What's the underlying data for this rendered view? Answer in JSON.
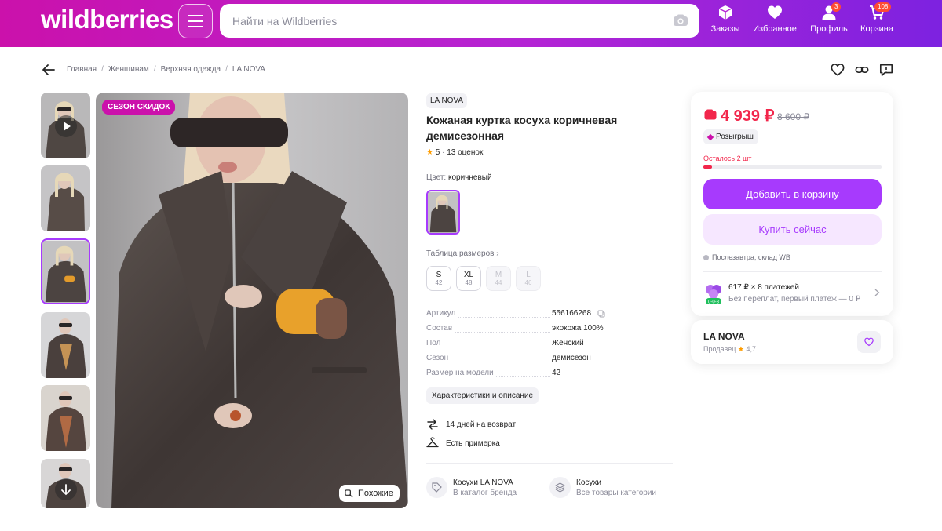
{
  "header": {
    "logo": "wildberries",
    "search_placeholder": "Найти на Wildberries",
    "nav": {
      "orders": "Заказы",
      "favorites": "Избранное",
      "profile": "Профиль",
      "profile_badge": "3",
      "cart": "Корзина",
      "cart_badge": "108"
    }
  },
  "breadcrumb": [
    "Главная",
    "Женщинам",
    "Верхняя одежда",
    "LA NOVA"
  ],
  "gallery": {
    "badge": "СЕЗОН СКИДОК",
    "similar": "Похожие",
    "thumb_count": 6,
    "active_thumb": 3
  },
  "product": {
    "brand": "LA NOVA",
    "title": "Кожаная куртка косуха коричневая демисезонная",
    "rating": "5",
    "reviews": "13 оценок",
    "color_label": "Цвет:",
    "color_value": "коричневый",
    "size_table": "Таблица размеров",
    "sizes": [
      {
        "name": "S",
        "ru": "42",
        "available": true
      },
      {
        "name": "XL",
        "ru": "48",
        "available": true
      },
      {
        "name": "M",
        "ru": "44",
        "available": false
      },
      {
        "name": "L",
        "ru": "46",
        "available": false
      }
    ],
    "specs": [
      {
        "k": "Артикул",
        "v": "556166268"
      },
      {
        "k": "Состав",
        "v": "экокожа 100%"
      },
      {
        "k": "Пол",
        "v": "Женский"
      },
      {
        "k": "Сезон",
        "v": "демисезон"
      },
      {
        "k": "Размер на модели",
        "v": "42"
      }
    ],
    "chars_button": "Характеристики и описание",
    "features": [
      "14 дней на возврат",
      "Есть примерка"
    ],
    "catalog_links": [
      {
        "title": "Косухи LA NOVA",
        "sub": "В каталог бренда",
        "icon": "tag-icon"
      },
      {
        "title": "Косухи",
        "sub": "Все товары категории",
        "icon": "layers-icon"
      }
    ]
  },
  "buy": {
    "price": "4 939 ₽",
    "old_price": "8 600 ₽",
    "raffle": "Розыгрыш",
    "stock": "Осталось 2 шт",
    "stock_level": 0.05,
    "add_to_cart": "Добавить в корзину",
    "buy_now": "Купить сейчас",
    "delivery": "Послезавтра, склад WB",
    "split_title": "617 ₽ × 8 платежей",
    "split_sub": "Без переплат, первый платёж — 0 ₽",
    "split_badge": "0-0-8"
  },
  "seller": {
    "name": "LA NOVA",
    "label": "Продавец",
    "rating": "4,7"
  },
  "colors": {
    "accent": "#a73afd",
    "brand": "#cb11ab",
    "price": "#f2264b"
  }
}
